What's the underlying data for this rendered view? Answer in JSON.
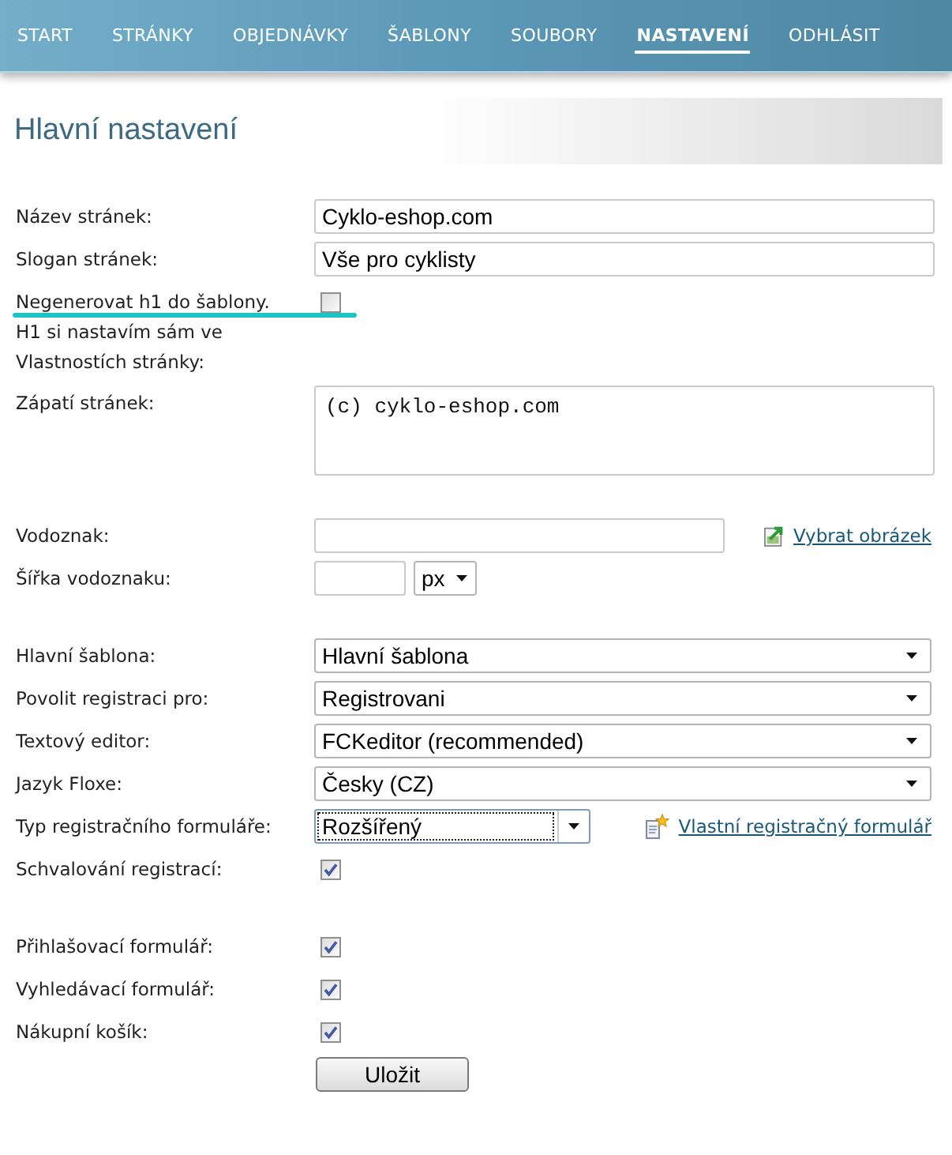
{
  "nav": [
    {
      "label": "START",
      "selected": false
    },
    {
      "label": "STRÁNKY",
      "selected": false
    },
    {
      "label": "OBJEDNÁVKY",
      "selected": false
    },
    {
      "label": "ŠABLONY",
      "selected": false
    },
    {
      "label": "SOUBORY",
      "selected": false
    },
    {
      "label": "NASTAVENÍ",
      "selected": true
    },
    {
      "label": "ODHLÁSIT",
      "selected": false
    }
  ],
  "heading": "Hlavní nastavení",
  "form": {
    "groups": [
      {
        "fields": [
          {
            "kind": "text",
            "label": "Název stránek:",
            "value": "Cyklo-eshop.com"
          },
          {
            "kind": "text",
            "label": "Slogan stránek:",
            "value": "Vše pro cyklisty"
          },
          {
            "kind": "checkbox",
            "label": "Negenerovat h1 do šablony.",
            "note": "H1 si nastavím sám ve Vlastnostích stránky:",
            "checked": false,
            "annotated": true
          },
          {
            "kind": "textarea",
            "label": "Zápatí stránek:",
            "value": "(c) cyklo-eshop.com"
          }
        ]
      },
      {
        "fields": [
          {
            "kind": "text",
            "label": "Vodoznak:",
            "link": "Vybrat obrázek"
          },
          {
            "kind": "size",
            "label": "Šířka vodoznaku:",
            "unit": "px"
          }
        ]
      },
      {
        "fields": [
          {
            "kind": "select",
            "label": "Hlavní šablona:",
            "value": "Hlavní šablona"
          },
          {
            "kind": "select",
            "label": "Povolit registraci pro:",
            "value": "Registrovani"
          },
          {
            "kind": "select",
            "label": "Textový editor:",
            "value": "FCKeditor (recommended)"
          },
          {
            "kind": "select",
            "label": "Jazyk Floxe:",
            "value": "Česky (CZ)"
          },
          {
            "kind": "select",
            "label": "Typ registračního formuláře:",
            "value": "Rozšířený",
            "focused": true,
            "link": "Vlastní registračný formulář"
          },
          {
            "kind": "checkbox",
            "label": "Schvalování registrací:",
            "checked": true
          }
        ]
      },
      {
        "fields": [
          {
            "kind": "checkbox",
            "label": "Přihlašovací formulář:",
            "checked": true
          },
          {
            "kind": "checkbox",
            "label": "Vyhledávací formulář:",
            "checked": true
          },
          {
            "kind": "checkbox",
            "label": "Nákupní košík:",
            "checked": true
          }
        ]
      }
    ],
    "save_button": "Uložit"
  }
}
